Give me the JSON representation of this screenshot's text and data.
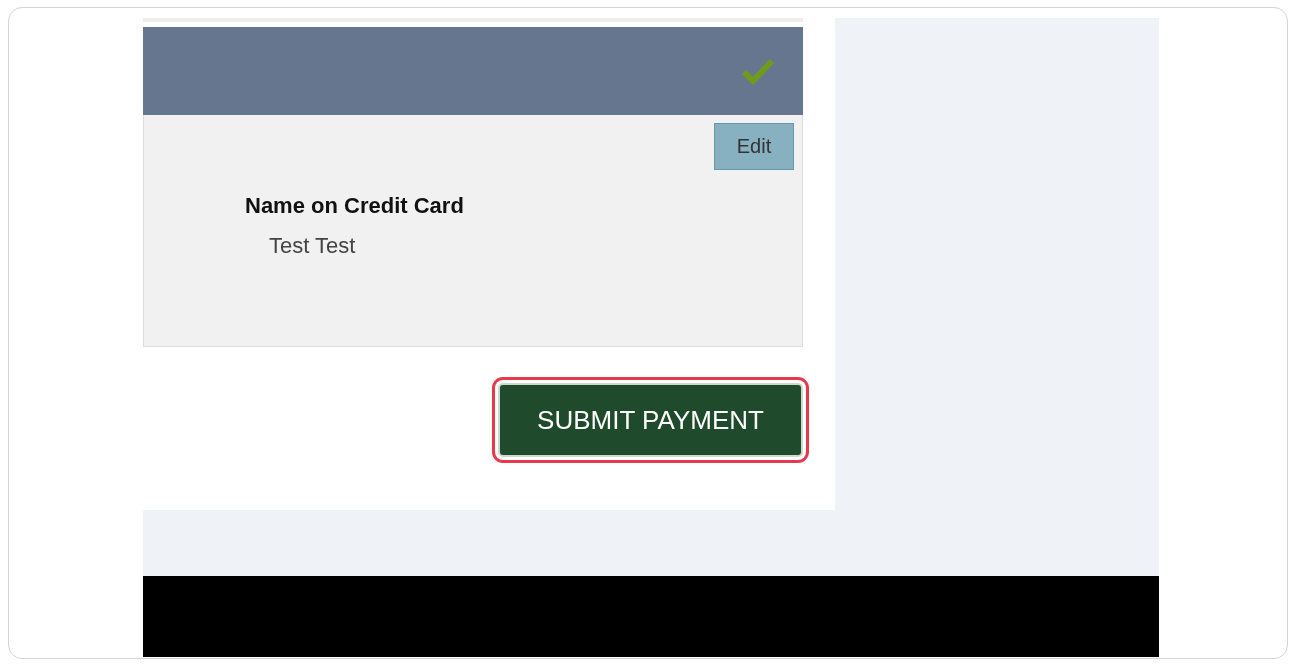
{
  "payment_section": {
    "completed": true,
    "edit_button": "Edit",
    "field_label": "Name on Credit Card",
    "field_value": "Test Test"
  },
  "submit_button": {
    "label": "SUBMIT PAYMENT",
    "highlighted": true
  }
}
